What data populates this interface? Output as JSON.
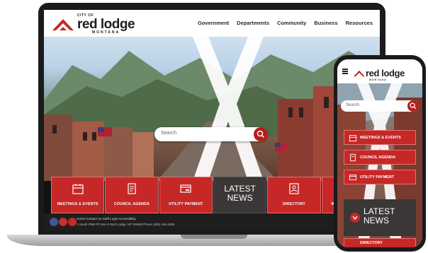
{
  "brand": {
    "city_of": "CITY OF",
    "name": "red lodge",
    "state": "MONTANA",
    "accent": "#c62828",
    "dark": "#3b3737"
  },
  "nav": [
    "Government",
    "Departments",
    "Community",
    "Business",
    "Resources"
  ],
  "search": {
    "placeholder": "Search"
  },
  "quick_links": [
    {
      "label": "MEETINGS & EVENTS",
      "icon": "calendar-icon"
    },
    {
      "label": "COUNCIL AGENDA",
      "icon": "document-icon"
    },
    {
      "label": "UTILITY PAYMENT",
      "icon": "payment-icon"
    },
    {
      "label": "LATEST NEWS",
      "featured": true
    },
    {
      "label": "DIRECTORY",
      "icon": "directory-icon"
    },
    {
      "label": "MUNICIPAL CODE",
      "icon": "building-icon"
    }
  ],
  "footer": {
    "links": "Home   Contact Us   Staff Login   Accessibility",
    "address": "1 South Platt  PO Box 9   Red Lodge, MT 59068   Phone (406) 446-1606",
    "social": [
      "facebook-icon",
      "youtube-icon",
      "email-icon"
    ]
  },
  "phone": {
    "search_placeholder": "Search",
    "buttons": [
      "MEETINGS & EVENTS",
      "COUNCIL AGENDA",
      "UTILITY PAYMENT"
    ],
    "news": "LATEST NEWS",
    "directory": "DIRECTORY"
  }
}
